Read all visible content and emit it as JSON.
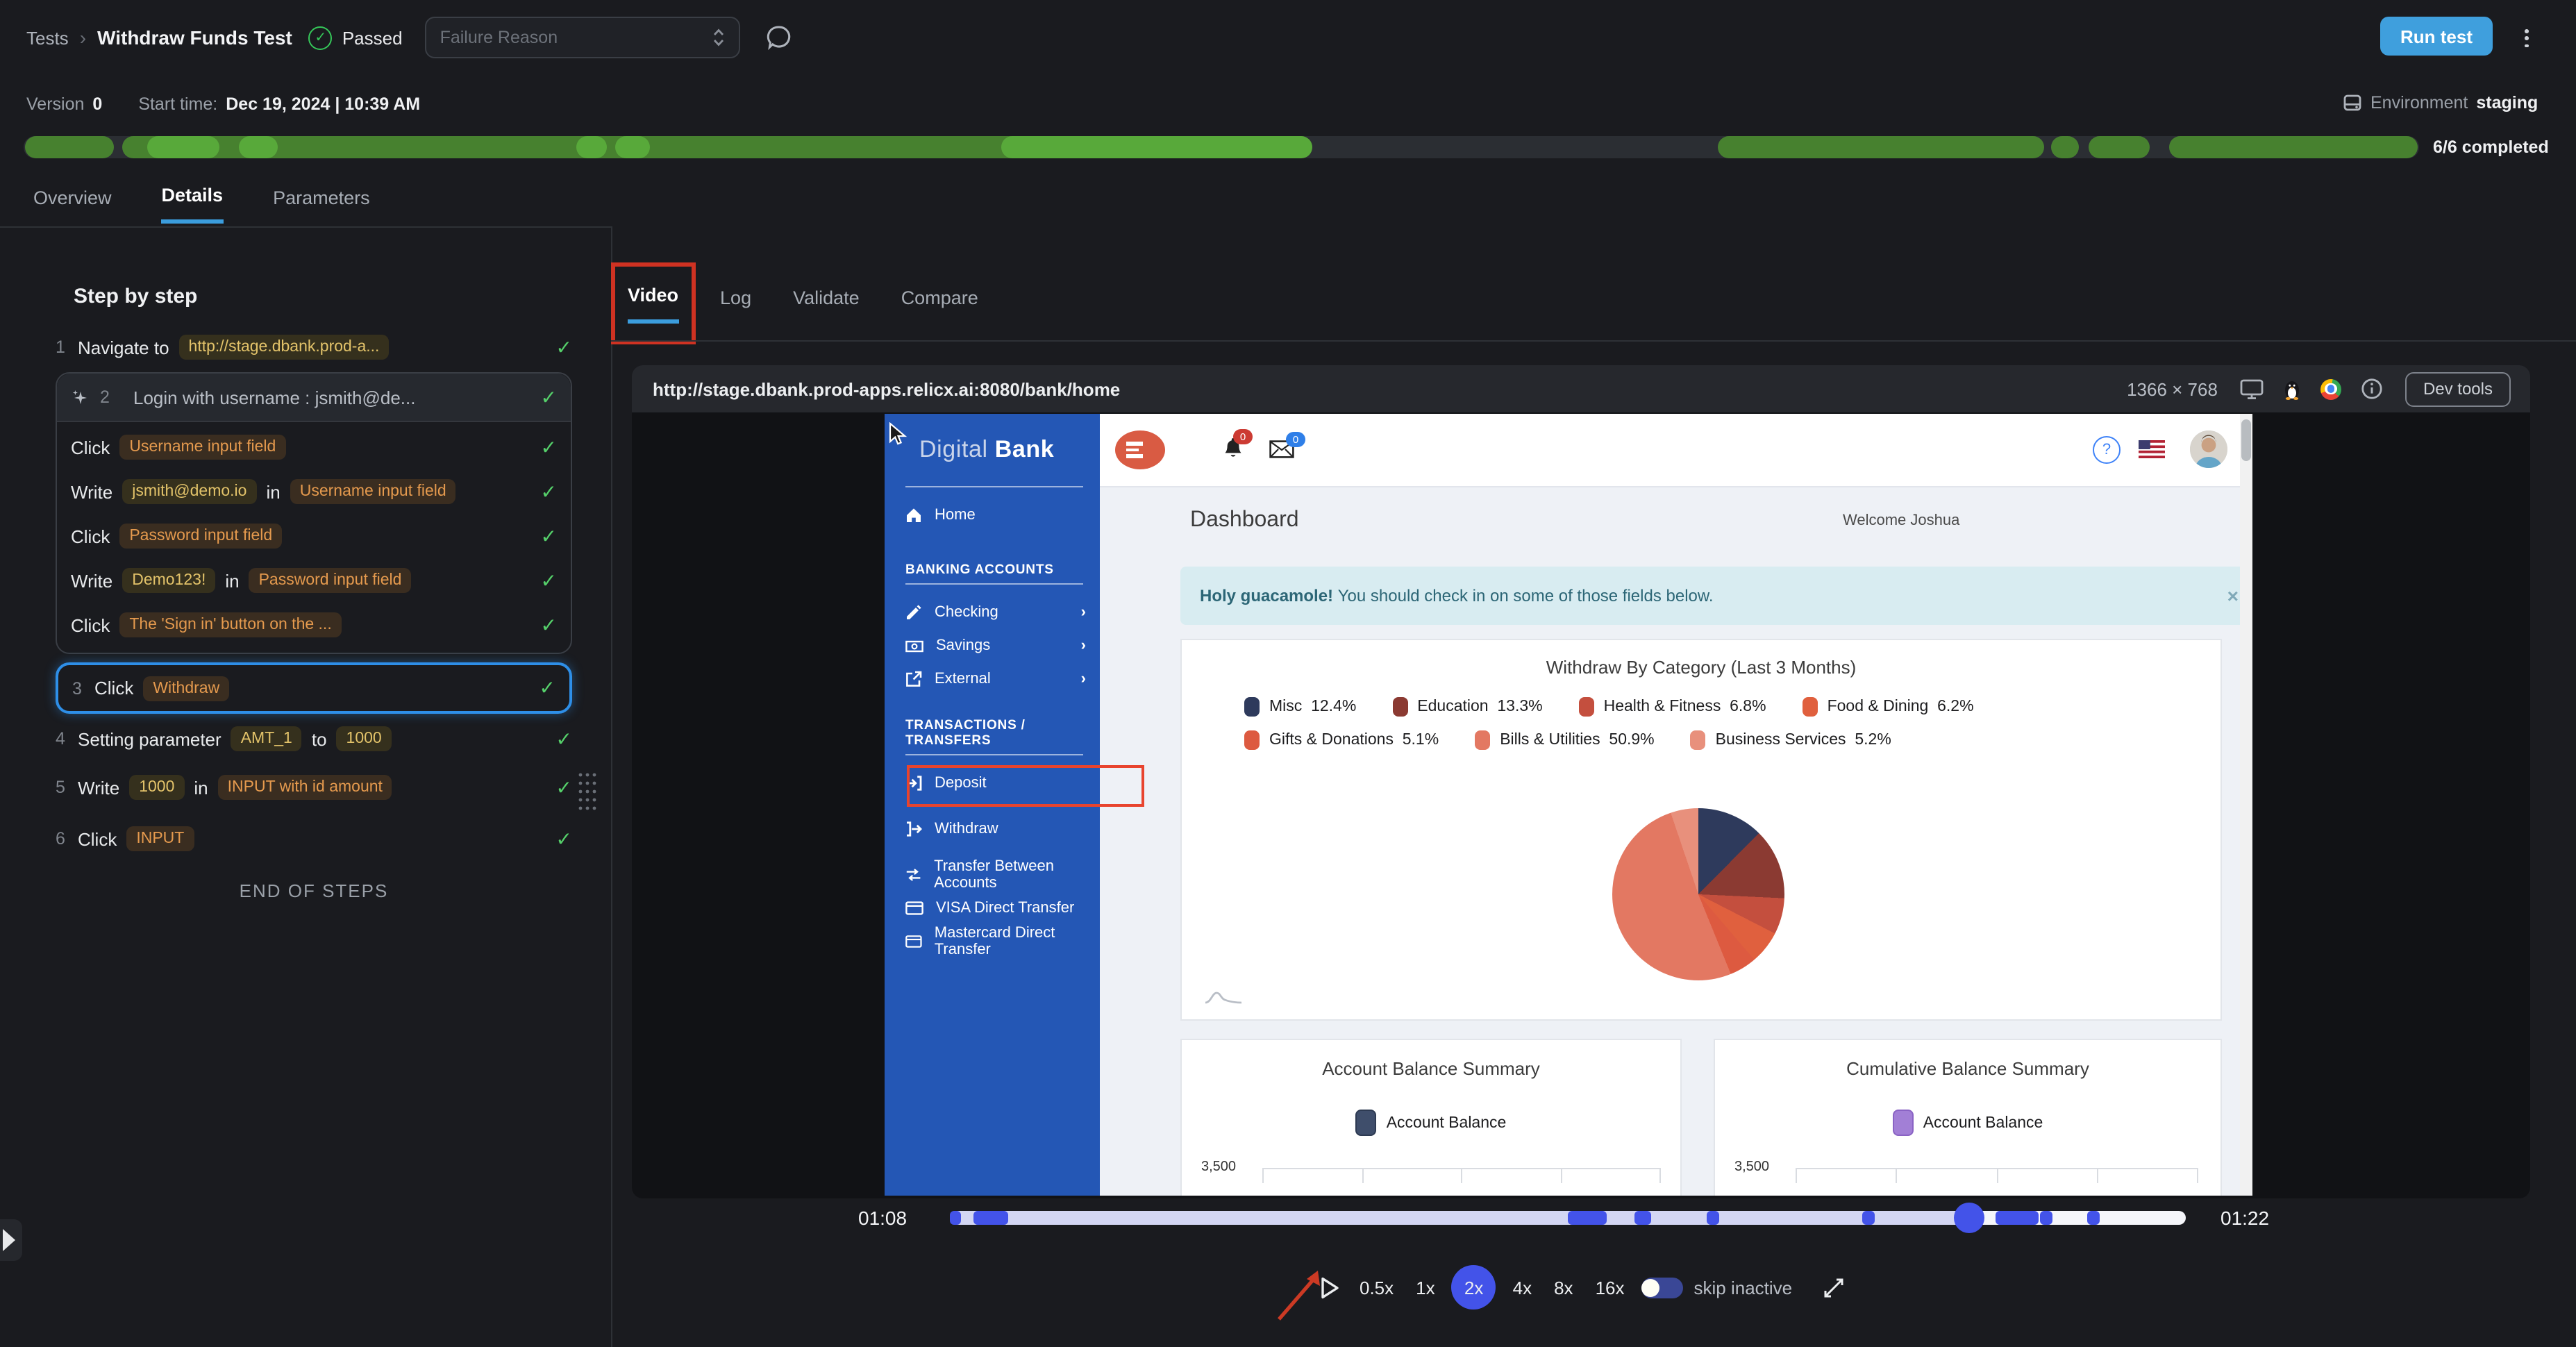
{
  "ui": {
    "check": "✓",
    "close": "×",
    "chevron": "›",
    "end_of_steps": "END OF STEPS"
  },
  "header": {
    "breadcrumb_root": "Tests",
    "title": "Withdraw Funds Test",
    "status": "Passed",
    "failure_reason_placeholder": "Failure Reason",
    "run_test_label": "Run test"
  },
  "meta": {
    "version_label": "Version",
    "version": "0",
    "start_label": "Start time:",
    "start_value": "Dec 19, 2024 | 10:39 AM",
    "environment_label": "Environment",
    "environment": "staging",
    "completed": "6/6 completed"
  },
  "tabs": {
    "overview": "Overview",
    "details": "Details",
    "parameters": "Parameters"
  },
  "panel": {
    "title": "Step by step"
  },
  "steps": {
    "s1": {
      "num": "1",
      "action": "Navigate to",
      "value": "http://stage.dbank.prod-a..."
    },
    "group": {
      "num": "2",
      "label": "Login with username : jsmith@de..."
    },
    "g1": {
      "action": "Click",
      "target": "Username input field"
    },
    "g2": {
      "action": "Write",
      "value": "jsmith@demo.io",
      "conj": "in",
      "target": "Username input field"
    },
    "g3": {
      "action": "Click",
      "target": "Password input field"
    },
    "g4": {
      "action": "Write",
      "value": "Demo123!",
      "conj": "in",
      "target": "Password input field"
    },
    "g5": {
      "action": "Click",
      "target": "The 'Sign in' button on the ..."
    },
    "s3": {
      "num": "3",
      "action": "Click",
      "target": "Withdraw"
    },
    "s4": {
      "num": "4",
      "action": "Setting parameter",
      "name": "AMT_1",
      "conj": "to",
      "value": "1000"
    },
    "s5": {
      "num": "5",
      "action": "Write",
      "value": "1000",
      "conj": "in",
      "target": "INPUT with id amount"
    },
    "s6": {
      "num": "6",
      "action": "Click",
      "target": "INPUT"
    }
  },
  "right_tabs": {
    "video": "Video",
    "log": "Log",
    "validate": "Validate",
    "compare": "Compare"
  },
  "video": {
    "url": "http://stage.dbank.prod-apps.relicx.ai:8080/bank/home",
    "resolution": "1366 × 768",
    "devtools_label": "Dev tools"
  },
  "bank": {
    "brand_light": "Digital",
    "brand_bold": "Bank",
    "bell_badge": "0",
    "mail_badge": "0",
    "nav": {
      "home": "Home",
      "sec_accounts": "BANKING ACCOUNTS",
      "checking": "Checking",
      "savings": "Savings",
      "external": "External",
      "sec_transactions": "TRANSACTIONS / TRANSFERS",
      "deposit": "Deposit",
      "withdraw": "Withdraw",
      "transfer": "Transfer Between Accounts",
      "visa": "VISA Direct Transfer",
      "mastercard": "Mastercard Direct Transfer"
    },
    "page_title": "Dashboard",
    "welcome": "Welcome Joshua",
    "alert_bold": "Holy guacamole!",
    "alert_text": "You should check in on some of those fields below."
  },
  "player": {
    "time_start": "01:08",
    "time_end": "01:22",
    "speeds": [
      "0.5x",
      "1x",
      "2x",
      "4x",
      "8x",
      "16x"
    ],
    "active_speed": "2x",
    "skip_label": "skip inactive"
  },
  "chart_data": [
    {
      "type": "pie",
      "title": "Withdraw By Category (Last 3 Months)",
      "categories": [
        "Misc",
        "Education",
        "Health & Fitness",
        "Food & Dining",
        "Gifts & Donations",
        "Bills & Utilities",
        "Business Services"
      ],
      "values": [
        12.4,
        13.3,
        6.8,
        6.2,
        5.1,
        50.9,
        5.2
      ],
      "unit": "%",
      "colors": [
        "#2e3a5c",
        "#8b3a32",
        "#c44f3e",
        "#e0603e",
        "#dd5a40",
        "#e37862",
        "#e8907c"
      ],
      "legend_position": "top",
      "legend": [
        {
          "label": "Misc",
          "pct": "12.4%"
        },
        {
          "label": "Education",
          "pct": "13.3%"
        },
        {
          "label": "Health & Fitness",
          "pct": "6.8%"
        },
        {
          "label": "Food & Dining",
          "pct": "6.2%"
        },
        {
          "label": "Gifts & Donations",
          "pct": "5.1%"
        },
        {
          "label": "Bills & Utilities",
          "pct": "50.9%"
        },
        {
          "label": "Business Services",
          "pct": "5.2%"
        }
      ]
    },
    {
      "type": "line",
      "title": "Account Balance Summary",
      "series": [
        {
          "name": "Account Balance",
          "color": "#3f4e6b"
        }
      ],
      "y_tick_labels": [
        "3,500"
      ]
    },
    {
      "type": "line",
      "title": "Cumulative Balance Summary",
      "series": [
        {
          "name": "Account Balance",
          "color": "#a27fd6"
        }
      ],
      "y_tick_labels": [
        "3,500"
      ]
    }
  ],
  "colors": {
    "accent_blue": "#2e8fe8",
    "run_button": "#3f9fdd",
    "progress_green_dark": "#47812f",
    "progress_green_light": "#58a93a",
    "timeline_blue": "#4353e9",
    "annotation_red": "#cf3222",
    "bank_sidebar_blue": "#2457b5",
    "bank_alert_bg": "#d8ecf1"
  }
}
